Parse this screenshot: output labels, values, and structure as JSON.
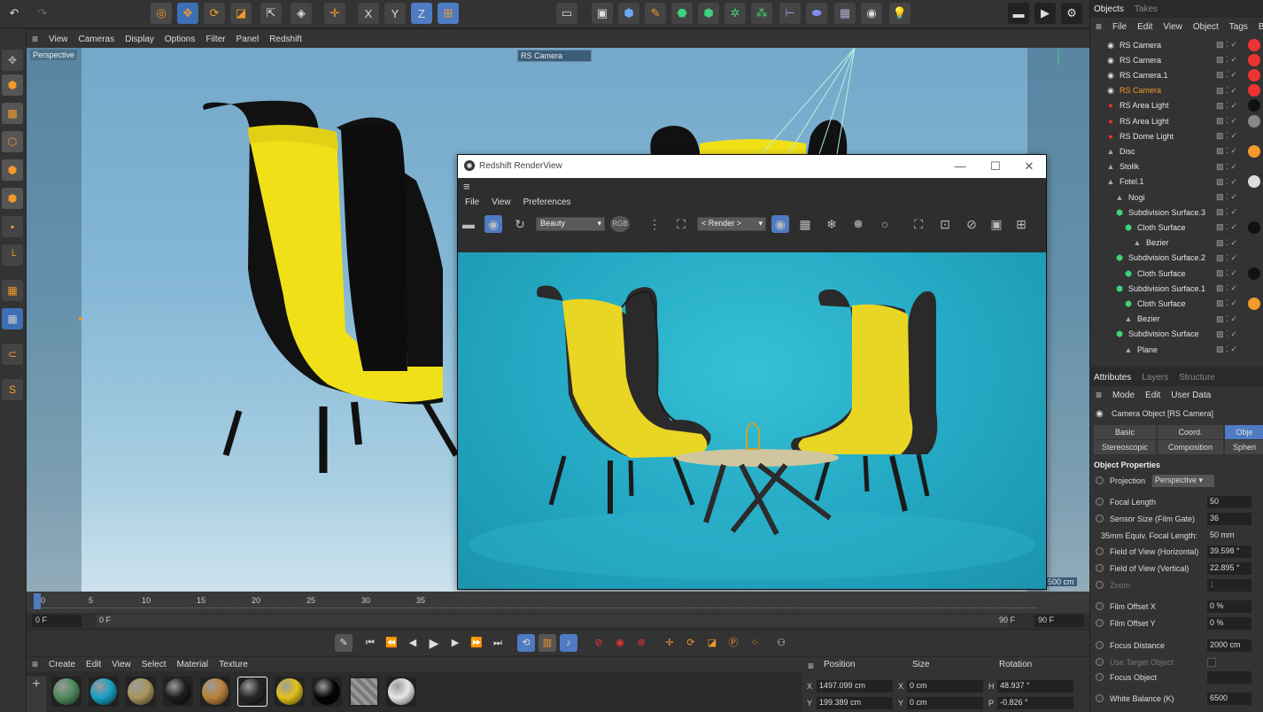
{
  "toolbar": {
    "axis_x": "X",
    "axis_y": "Y",
    "axis_z": "Z"
  },
  "viewport": {
    "menu": [
      "View",
      "Cameras",
      "Display",
      "Options",
      "Filter",
      "Panel",
      "Redshift"
    ],
    "label": "Perspective",
    "camera_label": "RS Camera",
    "distance": "500 cm"
  },
  "renderview": {
    "title": "Redshift RenderView",
    "menu": [
      "File",
      "View",
      "Preferences"
    ],
    "aov_select": "Beauty",
    "rgb_label": "RGB",
    "render_select": "< Render >"
  },
  "timeline": {
    "ticks": [
      "0",
      "5",
      "10",
      "15",
      "20",
      "25",
      "30",
      "35"
    ],
    "start_field": "0 F",
    "current_field": "0 F",
    "end_field": "90 F",
    "end_field2": "90 F"
  },
  "materials": {
    "menu": [
      "Create",
      "Edit",
      "View",
      "Select",
      "Material",
      "Texture"
    ],
    "swatches": [
      {
        "color": "#4f8a5e"
      },
      {
        "color": "#1ba0c3"
      },
      {
        "color": "#a8965c"
      },
      {
        "color": "#1c1c1c"
      },
      {
        "color": "#b8823d"
      },
      {
        "color": "#262626"
      },
      {
        "color": "#e3c21a"
      },
      {
        "color": "#050505"
      },
      {
        "color": "#7a7a7a"
      },
      {
        "color": "#e8e8e8"
      }
    ]
  },
  "coords": {
    "headers": {
      "position": "Position",
      "size": "Size",
      "rotation": "Rotation"
    },
    "rows": [
      {
        "axis": "X",
        "position": "1497.099 cm",
        "size_axis": "X",
        "size": "0 cm",
        "rot_axis": "H",
        "rotation": "48.937 °"
      },
      {
        "axis": "Y",
        "position": "199.389 cm",
        "size_axis": "Y",
        "size": "0 cm",
        "rot_axis": "P",
        "rotation": "-0.826 °"
      }
    ]
  },
  "objects_panel": {
    "tabs": [
      "Objects",
      "Takes"
    ],
    "menu": [
      "File",
      "Edit",
      "View",
      "Object",
      "Tags",
      "Boo"
    ],
    "items": [
      {
        "name": "RS Camera",
        "indent": 0,
        "highlight": false
      },
      {
        "name": "RS Camera",
        "indent": 0,
        "highlight": false
      },
      {
        "name": "RS Camera.1",
        "indent": 0,
        "highlight": false
      },
      {
        "name": "RS Camera",
        "indent": 0,
        "highlight": true
      },
      {
        "name": "RS Area Light",
        "indent": 0,
        "highlight": false
      },
      {
        "name": "RS Area Light",
        "indent": 0,
        "highlight": false
      },
      {
        "name": "RS Dome Light",
        "indent": 0,
        "highlight": false
      },
      {
        "name": "Disc",
        "indent": 0,
        "highlight": false
      },
      {
        "name": "Stolik",
        "indent": 0,
        "highlight": false
      },
      {
        "name": "Fotel.1",
        "indent": 0,
        "highlight": false
      },
      {
        "name": "Nogi",
        "indent": 1,
        "highlight": false
      },
      {
        "name": "Subdivision Surface.3",
        "indent": 1,
        "highlight": false
      },
      {
        "name": "Cloth Surface",
        "indent": 2,
        "highlight": false
      },
      {
        "name": "Bezier",
        "indent": 3,
        "highlight": false
      },
      {
        "name": "Subdivision Surface.2",
        "indent": 1,
        "highlight": false
      },
      {
        "name": "Cloth Surface",
        "indent": 2,
        "highlight": false
      },
      {
        "name": "Subdivision Surface.1",
        "indent": 1,
        "highlight": false
      },
      {
        "name": "Cloth Surface",
        "indent": 2,
        "highlight": false
      },
      {
        "name": "Bezier",
        "indent": 2,
        "highlight": false
      },
      {
        "name": "Subdivision Surface",
        "indent": 1,
        "highlight": false
      },
      {
        "name": "Plane",
        "indent": 2,
        "highlight": false
      }
    ]
  },
  "attributes": {
    "tabs": [
      "Attributes",
      "Layers",
      "Structure"
    ],
    "menu": [
      "Mode",
      "Edit",
      "User Data"
    ],
    "object_title": "Camera Object [RS Camera]",
    "subtabs": [
      "Basic",
      "Coord.",
      "Obje",
      "Stereoscopic",
      "Composition",
      "Spheri"
    ],
    "section": "Object Properties",
    "projection_label": "Projection",
    "projection_value": "Perspective",
    "fields": [
      {
        "label": "Focal Length",
        "value": "50",
        "dim": false
      },
      {
        "label": "Sensor Size (Film Gate)",
        "value": "36",
        "dim": false
      },
      {
        "label": "35mm Equiv. Focal Length:",
        "value": "50 mm",
        "dim": false,
        "plain": true
      },
      {
        "label": "Field of View (Horizontal)",
        "value": "39.598 °",
        "dim": false
      },
      {
        "label": "Field of View (Vertical)",
        "value": "22.895 °",
        "dim": false
      },
      {
        "label": "Zoom",
        "value": "1",
        "dim": true
      },
      {
        "label": "Film Offset X",
        "value": "0 %",
        "dim": false
      },
      {
        "label": "Film Offset Y",
        "value": "0 %",
        "dim": false
      },
      {
        "label": "Focus Distance",
        "value": "2000 cm",
        "dim": false
      },
      {
        "label": "Use Target Object",
        "value": "",
        "dim": true
      },
      {
        "label": "Focus Object",
        "value": "",
        "dim": false
      },
      {
        "label": "White Balance (K)",
        "value": "6500",
        "dim": false
      }
    ]
  },
  "colors": {
    "accent_orange": "#f39a2b",
    "active_blue": "#4e7bc1",
    "chair_yellow": "#f5e020",
    "render_bg": "#26aac4"
  }
}
